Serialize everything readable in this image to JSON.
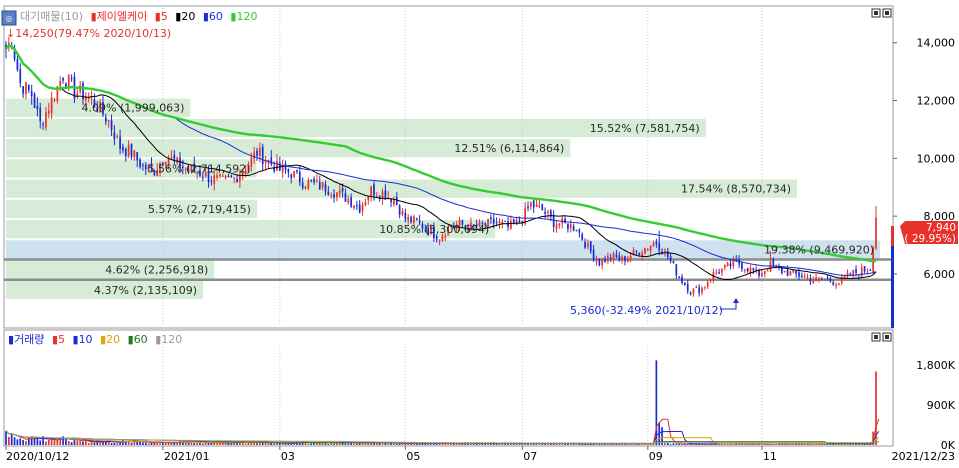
{
  "price_panel": {
    "legend": {
      "prefix": "대기매물(10)",
      "stock": "제이엘케이",
      "ma": [
        {
          "label": "5",
          "color": "#e8312a"
        },
        {
          "label": "20",
          "color": "#000000"
        },
        {
          "label": "60",
          "color": "#1a2bd6"
        },
        {
          "label": "120",
          "color": "#33cc33"
        }
      ]
    },
    "high_label": "14,250(79.47% 2020/10/13)",
    "low_label": "5,360(-32.49% 2021/10/12)",
    "current_price": "7,940",
    "current_change": "( 29.95%)",
    "hlines_color": "#8c8c8c",
    "colors": {
      "up": "#e8312a",
      "down": "#1a2bd6",
      "vp_band": "#d6ecd6",
      "vp_highlight": "#cde1ee"
    }
  },
  "volume_panel": {
    "legend": [
      {
        "label": "거래량",
        "color": "#1a2bd6"
      },
      {
        "label": "5",
        "color": "#e8312a"
      },
      {
        "label": "10",
        "color": "#1a2bd6"
      },
      {
        "label": "20",
        "color": "#e8a000"
      },
      {
        "label": "60",
        "color": "#1e7a1e"
      },
      {
        "label": "120",
        "color": "#9a9a9a"
      }
    ]
  },
  "x_axis": {
    "ticks": [
      {
        "label": "2020/10/12",
        "index": 0
      },
      {
        "label": "2021/01",
        "index": 55
      },
      {
        "label": "03",
        "index": 96
      },
      {
        "label": "05",
        "index": 140
      },
      {
        "label": "07",
        "index": 181
      },
      {
        "label": "09",
        "index": 225
      },
      {
        "label": "11",
        "index": 265
      }
    ],
    "end_label": "2021/12/23"
  },
  "chart_data": [
    {
      "type": "candlestick",
      "x_start": "2020/10/12",
      "x_end": "2021/12/23",
      "ylim": [
        4200,
        15200
      ],
      "y_ticks": [
        6000,
        8000,
        10000,
        12000,
        14000
      ],
      "y_tick_labels": [
        "6,000",
        "8,000",
        "10,000",
        "12,000",
        "14,000"
      ],
      "price_anchors": [
        [
          0,
          13800
        ],
        [
          2,
          14100
        ],
        [
          5,
          12600
        ],
        [
          9,
          12200
        ],
        [
          12,
          11200
        ],
        [
          16,
          12000
        ],
        [
          20,
          12900
        ],
        [
          24,
          12300
        ],
        [
          28,
          12200
        ],
        [
          32,
          11800
        ],
        [
          36,
          11300
        ],
        [
          40,
          10400
        ],
        [
          44,
          10200
        ],
        [
          48,
          9700
        ],
        [
          52,
          9600
        ],
        [
          56,
          10100
        ],
        [
          60,
          9800
        ],
        [
          64,
          9600
        ],
        [
          68,
          9500
        ],
        [
          72,
          9300
        ],
        [
          76,
          9200
        ],
        [
          80,
          9300
        ],
        [
          84,
          9700
        ],
        [
          88,
          10200
        ],
        [
          92,
          9900
        ],
        [
          96,
          9600
        ],
        [
          100,
          9500
        ],
        [
          104,
          9200
        ],
        [
          108,
          9100
        ],
        [
          112,
          9000
        ],
        [
          116,
          8800
        ],
        [
          120,
          8600
        ],
        [
          124,
          8300
        ],
        [
          128,
          8900
        ],
        [
          132,
          8800
        ],
        [
          136,
          8600
        ],
        [
          140,
          7900
        ],
        [
          144,
          7800
        ],
        [
          148,
          7500
        ],
        [
          152,
          7300
        ],
        [
          156,
          7700
        ],
        [
          160,
          7700
        ],
        [
          164,
          7600
        ],
        [
          168,
          7700
        ],
        [
          172,
          7800
        ],
        [
          176,
          7600
        ],
        [
          180,
          7800
        ],
        [
          184,
          8400
        ],
        [
          188,
          8200
        ],
        [
          192,
          7800
        ],
        [
          196,
          7700
        ],
        [
          200,
          7600
        ],
        [
          204,
          6900
        ],
        [
          208,
          6400
        ],
        [
          212,
          6600
        ],
        [
          216,
          6500
        ],
        [
          220,
          6700
        ],
        [
          224,
          6900
        ],
        [
          228,
          7100
        ],
        [
          232,
          6600
        ],
        [
          236,
          5900
        ],
        [
          240,
          5400
        ],
        [
          244,
          5500
        ],
        [
          248,
          6000
        ],
        [
          252,
          6200
        ],
        [
          256,
          6400
        ],
        [
          260,
          6200
        ],
        [
          264,
          6000
        ],
        [
          268,
          6300
        ],
        [
          272,
          6100
        ],
        [
          276,
          6000
        ],
        [
          280,
          5900
        ],
        [
          284,
          5800
        ],
        [
          288,
          5800
        ],
        [
          292,
          5700
        ],
        [
          296,
          6000
        ],
        [
          300,
          6100
        ],
        [
          303,
          6200
        ],
        [
          305,
          7940
        ]
      ],
      "spikes": [
        [
          229,
          7500
        ],
        [
          268,
          6800
        ],
        [
          305,
          8350
        ]
      ],
      "volume_profile": [
        {
          "label": "4.37% (2,135,109)",
          "low": 5100,
          "high": 5800,
          "volume": 2135109
        },
        {
          "label": "4.62% (2,256,918)",
          "low": 5800,
          "high": 6500,
          "volume": 2256918
        },
        {
          "label": "19.38% (9,469,920)",
          "low": 6500,
          "high": 7200,
          "volume": 9469920
        },
        {
          "label": "10.85% (5,300,694)",
          "low": 7200,
          "high": 7900,
          "volume": 5300694
        },
        {
          "label": "5.57% (2,719,415)",
          "low": 7900,
          "high": 8600,
          "volume": 2719415
        },
        {
          "label": "17.54% (8,570,734)",
          "low": 8600,
          "high": 9300,
          "volume": 8570734
        },
        {
          "label": "5.56% (2,714,592)",
          "low": 9300,
          "high": 10000,
          "volume": 2714592
        },
        {
          "label": "12.51% (6,114,864)",
          "low": 10000,
          "high": 10700,
          "volume": 6114864
        },
        {
          "label": "15.52% (7,581,754)",
          "low": 10700,
          "high": 11400,
          "volume": 7581754
        },
        {
          "label": "4.09% (1,999,063)",
          "low": 11400,
          "high": 12100,
          "volume": 1999063
        }
      ],
      "hlines": [
        6500,
        5800
      ]
    },
    {
      "type": "bar",
      "ylim": [
        0,
        2200000
      ],
      "y_ticks": [
        0,
        900000,
        1800000
      ],
      "y_tick_labels": [
        "0K",
        "900K",
        "1,800K"
      ],
      "volume_anchors": [
        [
          0,
          200000
        ],
        [
          10,
          150000
        ],
        [
          30,
          80000
        ],
        [
          60,
          60000
        ],
        [
          100,
          50000
        ],
        [
          150,
          40000
        ],
        [
          200,
          30000
        ],
        [
          260,
          25000
        ],
        [
          305,
          30000
        ]
      ],
      "volume_spikes": [
        [
          228,
          1900000
        ],
        [
          229,
          500000
        ],
        [
          230,
          400000
        ],
        [
          305,
          1650000
        ],
        [
          304,
          300000
        ],
        [
          306,
          900000
        ]
      ]
    }
  ]
}
